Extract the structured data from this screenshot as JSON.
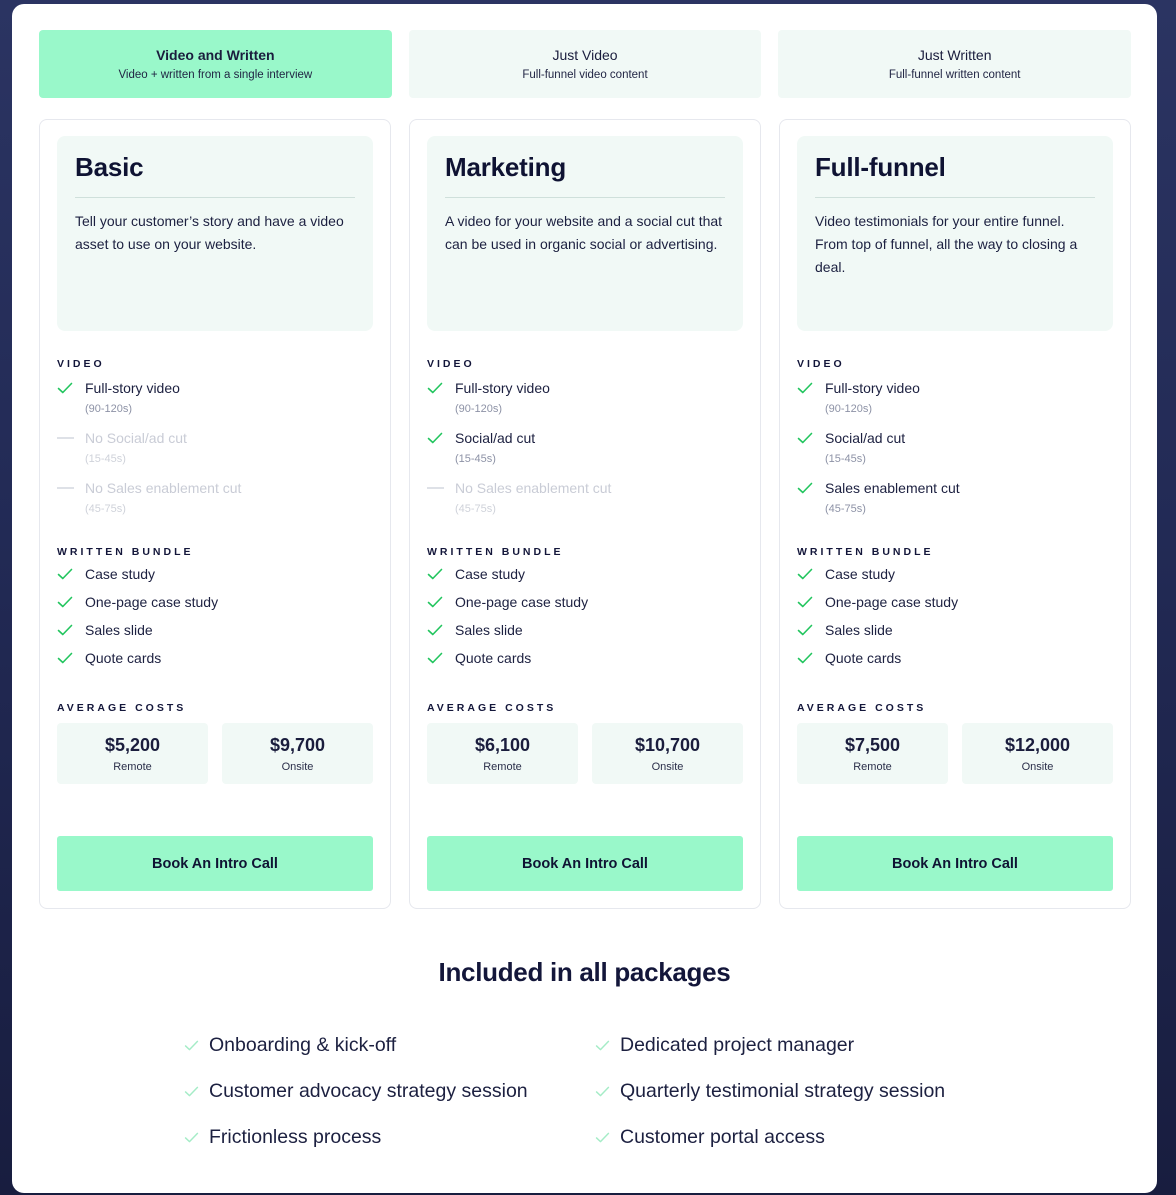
{
  "colors": {
    "accent": "#99f8ca",
    "card_bg": "#f1f9f6",
    "check": "#22c55e",
    "check_light": "#a5ecc7",
    "text_dark": "#13163a",
    "muted": "#c9ccd6",
    "page_bg": "#222a55"
  },
  "tabs": [
    {
      "title": "Video and Written",
      "subtitle": "Video + written from a single interview",
      "active": true
    },
    {
      "title": "Just Video",
      "subtitle": "Full-funnel video content",
      "active": false
    },
    {
      "title": "Just Written",
      "subtitle": "Full-funnel written content",
      "active": false
    }
  ],
  "labels": {
    "video": "VIDEO",
    "written": "WRITTEN BUNDLE",
    "costs": "AVERAGE COSTS",
    "remote": "Remote",
    "onsite": "Onsite",
    "cta": "Book An Intro Call"
  },
  "plans": [
    {
      "name": "Basic",
      "description": "Tell your customer’s story and have a video asset to use on your website.",
      "video": [
        {
          "label": "Full-story video",
          "sub": "(90-120s)",
          "included": true,
          "icon": "check-icon"
        },
        {
          "label": "No Social/ad cut",
          "sub": "(15-45s)",
          "included": false,
          "icon": "dash-icon"
        },
        {
          "label": "No Sales enablement cut",
          "sub": "(45-75s)",
          "included": false,
          "icon": "dash-icon"
        }
      ],
      "written": [
        {
          "label": "Case study",
          "included": true
        },
        {
          "label": "One-page case study",
          "included": true
        },
        {
          "label": "Sales slide",
          "included": true
        },
        {
          "label": "Quote cards",
          "included": true
        }
      ],
      "costs": {
        "remote": "$5,200",
        "onsite": "$9,700"
      }
    },
    {
      "name": "Marketing",
      "description": "A video for your website and a social cut that can be used in organic social or advertising.",
      "video": [
        {
          "label": "Full-story video",
          "sub": "(90-120s)",
          "included": true,
          "icon": "check-icon"
        },
        {
          "label": "Social/ad cut",
          "sub": "(15-45s)",
          "included": true,
          "icon": "check-icon"
        },
        {
          "label": "No Sales enablement cut",
          "sub": "(45-75s)",
          "included": false,
          "icon": "dash-icon"
        }
      ],
      "written": [
        {
          "label": "Case study",
          "included": true
        },
        {
          "label": "One-page case study",
          "included": true
        },
        {
          "label": "Sales slide",
          "included": true
        },
        {
          "label": "Quote cards",
          "included": true
        }
      ],
      "costs": {
        "remote": "$6,100",
        "onsite": "$10,700"
      }
    },
    {
      "name": "Full-funnel",
      "description": "Video testimonials for your entire funnel. From top of funnel, all the way to closing a deal.",
      "video": [
        {
          "label": "Full-story video",
          "sub": "(90-120s)",
          "included": true,
          "icon": "check-icon"
        },
        {
          "label": "Social/ad cut",
          "sub": "(15-45s)",
          "included": true,
          "icon": "check-icon"
        },
        {
          "label": "Sales enablement cut",
          "sub": "(45-75s)",
          "included": true,
          "icon": "check-icon"
        }
      ],
      "written": [
        {
          "label": "Case study",
          "included": true
        },
        {
          "label": "One-page case study",
          "included": true
        },
        {
          "label": "Sales slide",
          "included": true
        },
        {
          "label": "Quote cards",
          "included": true
        }
      ],
      "costs": {
        "remote": "$7,500",
        "onsite": "$12,000"
      }
    }
  ],
  "included": {
    "title": "Included in all packages",
    "items": [
      "Onboarding & kick-off",
      "Dedicated project manager",
      "Customer advocacy strategy session",
      "Quarterly testimonial strategy session",
      "Frictionless process",
      "Customer portal access"
    ]
  }
}
